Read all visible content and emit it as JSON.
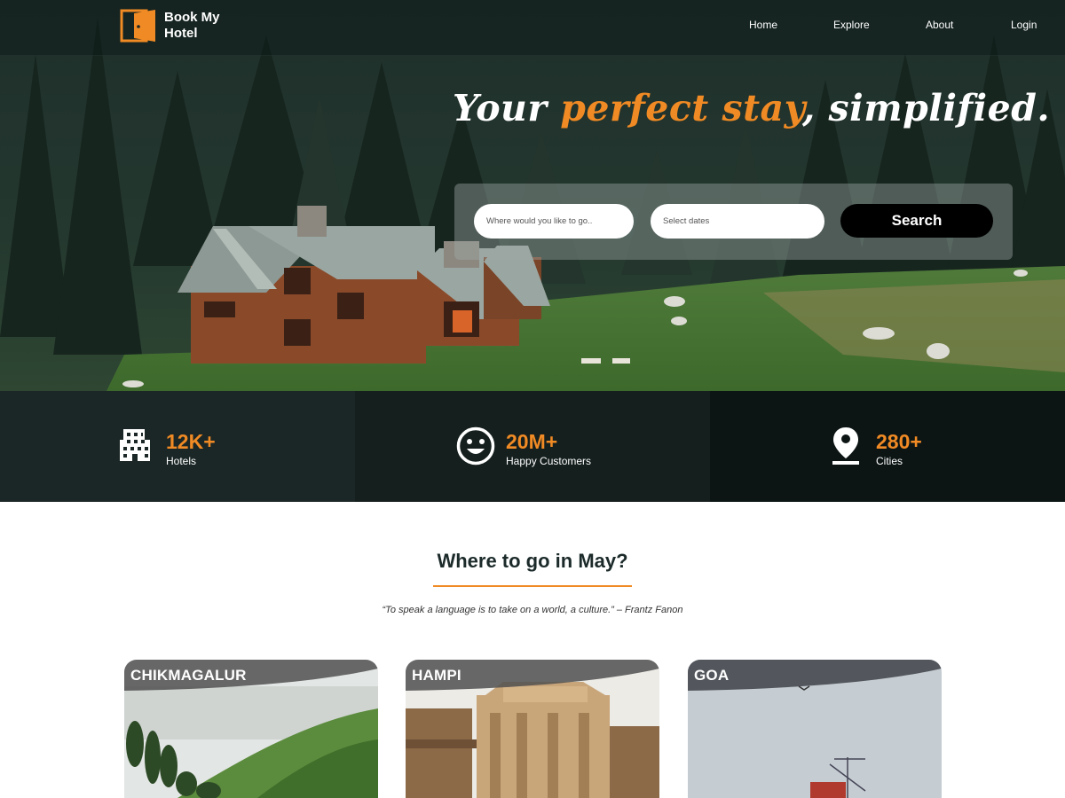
{
  "brand": {
    "name": "Book My Hotel",
    "line1": "Book My",
    "line2": "Hotel",
    "accent_color": "#f08a24"
  },
  "nav": {
    "items": [
      {
        "label": "Home"
      },
      {
        "label": "Explore"
      },
      {
        "label": "About"
      },
      {
        "label": "Login"
      }
    ]
  },
  "hero": {
    "headline_start": "Your ",
    "headline_accent": "perfect stay",
    "headline_end": ", simplified."
  },
  "search": {
    "destination_placeholder": "Where would you like to go..",
    "dates_placeholder": "Select dates",
    "button_label": "Search"
  },
  "stats": [
    {
      "value": "12K+",
      "label": "Hotels",
      "icon": "building-icon"
    },
    {
      "value": "20M+",
      "label": "Happy Customers",
      "icon": "smiley-icon"
    },
    {
      "value": "280+",
      "label": "Cities",
      "icon": "location-pin-icon"
    }
  ],
  "destinations_section": {
    "title": "Where to go in May?",
    "quote": "“To speak a language is to take on a world, a culture.” – Frantz Fanon"
  },
  "destinations": [
    {
      "name": "CHIKMAGALUR"
    },
    {
      "name": "HAMPI"
    },
    {
      "name": "GOA"
    }
  ]
}
